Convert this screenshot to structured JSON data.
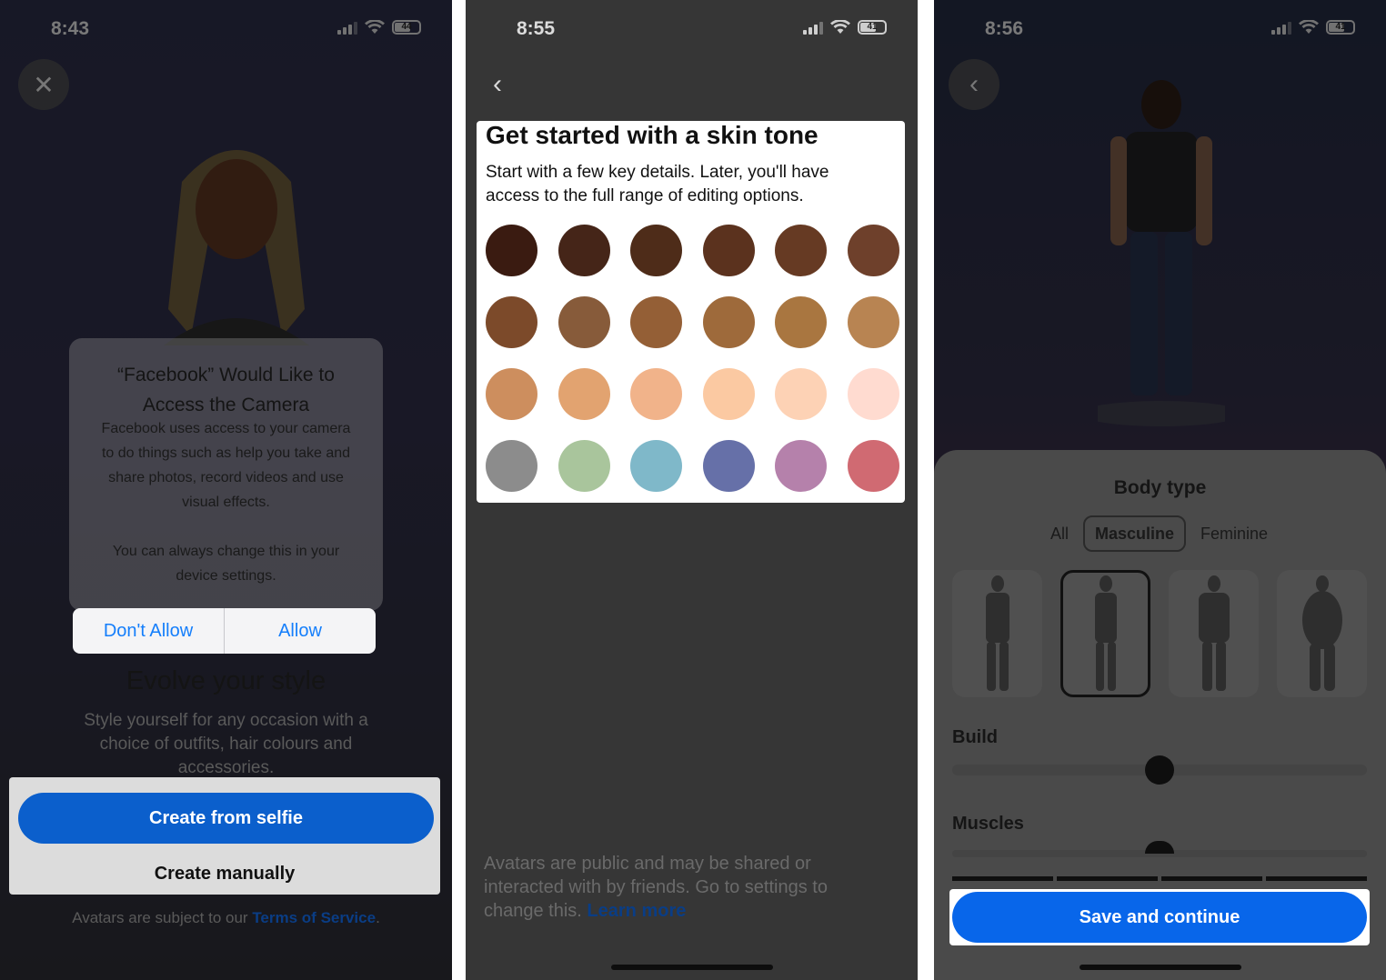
{
  "panel1": {
    "time": "8:43",
    "battery": "44",
    "close_icon": "close-icon",
    "alert": {
      "title_line1": "“Facebook” Would Like to",
      "title_line2": "Access the Camera",
      "body_line1": "Facebook uses access to your camera",
      "body_line2": "to do things such as help you take and",
      "body_line3": "share photos, record videos and use",
      "body_line4": "visual effects.",
      "body_line5": "You can always change this in your",
      "body_line6": "device settings.",
      "dont_allow": "Don't Allow",
      "allow": "Allow"
    },
    "heading": "Evolve your style",
    "sub_line1": "Style yourself for any occasion with a",
    "sub_line2": "choice of outfits, hair colours and",
    "sub_line3": "accessories.",
    "create_selfie": "Create from selfie",
    "create_manually": "Create manually",
    "terms_prefix": "Avatars are subject to our ",
    "terms_link": "Terms of Service",
    "terms_suffix": "."
  },
  "panel2": {
    "time": "8:55",
    "battery": "41",
    "back_icon": "back-chevron-icon",
    "title": "Get started with a skin tone",
    "description_line1": "Start with a few key details. Later, you'll have",
    "description_line2": "access to the full range of editing options.",
    "swatches": [
      "#3a1b11",
      "#452518",
      "#4e2c19",
      "#5b321e",
      "#663a23",
      "#6e402b",
      "#7c4a2a",
      "#875b3a",
      "#945f36",
      "#9e6a3b",
      "#a97640",
      "#b88452",
      "#cd8e5e",
      "#e2a370",
      "#f1b38a",
      "#fbc9a2",
      "#fdd2b5",
      "#ffdbd0",
      "#8c8c8c",
      "#a9c59c",
      "#7fb8c9",
      "#6670a8",
      "#b581ab",
      "#d06a72"
    ],
    "disclaimer_line1": "Avatars are public and may be shared or",
    "disclaimer_line2": "interacted with by friends. Go to settings to",
    "disclaimer_line3": "change this. ",
    "learn_more": "Learn more"
  },
  "panel3": {
    "time": "8:56",
    "battery": "41",
    "back_icon": "back-chevron-icon",
    "body_type_title": "Body type",
    "segments": [
      "All",
      "Masculine",
      "Feminine"
    ],
    "selected_segment": "Masculine",
    "selected_body_index": 1,
    "build_label": "Build",
    "build_value": 0.5,
    "muscles_label": "Muscles",
    "save_label": "Save and continue"
  }
}
